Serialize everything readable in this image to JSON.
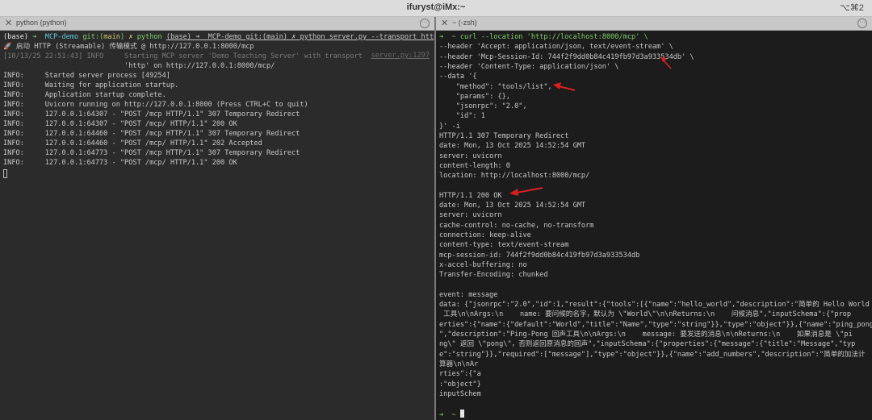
{
  "window": {
    "title": "ifuryst@iMx:~",
    "shortcut": "⌥⌘2"
  },
  "tabs": {
    "left": {
      "label": "python (python)"
    },
    "right": {
      "label": "~ (-zsh)"
    }
  },
  "left": {
    "lines": [
      "(base) ➜  MCP-demo git:(main) ✗ python server.py --transport http --port 8000",
      "🚀 启动 HTTP (Streamable) 传输模式 @ http://127.0.0.1:8000/mcp",
      "[10/13/25 22:51:43] INFO     Starting MCP server 'Demo Teaching Server' with transport",
      "                             'http' on http://127.0.0.1:8000/mcp/",
      "INFO:     Started server process [49254]",
      "INFO:     Waiting for application startup.",
      "INFO:     Application startup complete.",
      "INFO:     Uvicorn running on http://127.0.0.1:8000 (Press CTRL+C to quit)",
      "INFO:     127.0.0.1:64307 - \"POST /mcp HTTP/1.1\" 307 Temporary Redirect",
      "INFO:     127.0.0.1:64307 - \"POST /mcp/ HTTP/1.1\" 200 OK",
      "INFO:     127.0.0.1:64460 - \"POST /mcp HTTP/1.1\" 307 Temporary Redirect",
      "INFO:     127.0.0.1:64460 - \"POST /mcp/ HTTP/1.1\" 202 Accepted",
      "INFO:     127.0.0.1:64773 - \"POST /mcp HTTP/1.1\" 307 Temporary Redirect",
      "INFO:     127.0.0.1:64773 - \"POST /mcp/ HTTP/1.1\" 200 OK"
    ],
    "log_ref": "server.py:1297"
  },
  "right": {
    "lines": [
      "➜  ~ curl --location 'http://localhost:8000/mcp' \\",
      "--header 'Accept: application/json, text/event-stream' \\",
      "--header 'Mcp-Session-Id: 744f2f9dd0b84c419fb97d3a933534db' \\",
      "--header 'Content-Type: application/json' \\",
      "--data '{",
      "    \"method\": \"tools/list\",",
      "    \"params\": {},",
      "    \"jsonrpc\": \"2.0\",",
      "    \"id\": 1",
      "}' -i",
      "HTTP/1.1 307 Temporary Redirect",
      "date: Mon, 13 Oct 2025 14:52:54 GMT",
      "server: uvicorn",
      "content-length: 0",
      "location: http://localhost:8000/mcp/",
      "",
      "HTTP/1.1 200 OK",
      "date: Mon, 13 Oct 2025 14:52:54 GMT",
      "server: uvicorn",
      "cache-control: no-cache, no-transform",
      "connection: keep-alive",
      "content-type: text/event-stream",
      "mcp-session-id: 744f2f9dd0b84c419fb97d3a933534db",
      "x-accel-buffering: no",
      "Transfer-Encoding: chunked",
      "",
      "event: message",
      "data: {\"jsonrpc\":\"2.0\",\"id\":1,\"result\":{\"tools\":[{\"name\":\"hello_world\",\"description\":\"简单的 Hello World",
      " 工具\\n\\nArgs:\\n    name: 要问候的名字，默认为 \\\"World\\\"\\n\\nReturns:\\n    问候消息\",\"inputSchema\":{\"prop",
      "erties\":{\"name\":{\"default\":\"World\",\"title\":\"Name\",\"type\":\"string\"}},\"type\":\"object\"}},{\"name\":\"ping_pong",
      "\",\"description\":\"Ping-Pong 回声工具\\n\\nArgs:\\n    message: 要发送的消息\\n\\nReturns:\\n    如果消息是 \\\"pi",
      "ng\\\" 返回 \\\"pong\\\"，否则返回原消息的回声\",\"inputSchema\":{\"properties\":{\"message\":{\"title\":\"Message\",\"typ",
      "e\":\"string\"}},\"required\":[\"message\"],\"type\":\"object\"}},{\"name\":\"add_numbers\",\"description\":\"简单的加法计",
      "算器\\n\\nAr",
      "rties\":{\"a",
      ":\"object\"}",
      "inputSchem"
    ],
    "prompt": "➜  ~ "
  }
}
